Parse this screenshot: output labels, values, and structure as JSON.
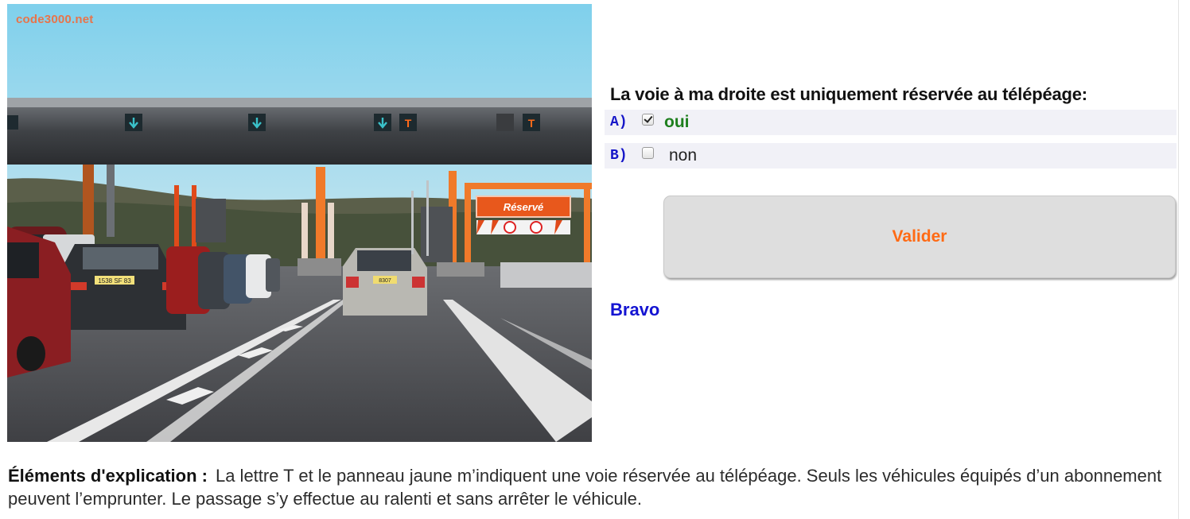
{
  "photo": {
    "watermark": "code3000.net",
    "sign_text": "Réservé",
    "plate_left": "1538 SF 83",
    "plate_center": "8307"
  },
  "question": {
    "text": "La voie à ma droite est uniquement réservée au télépéage:",
    "answers": [
      {
        "letter": "A)",
        "label": "oui",
        "checked": true
      },
      {
        "letter": "B)",
        "label": "non",
        "checked": false
      }
    ]
  },
  "button": {
    "label": "Valider"
  },
  "feedback": {
    "text": "Bravo"
  },
  "explanation": {
    "title": "Éléments d'explication :",
    "body": "La lettre T et le panneau jaune m’indiquent une voie réservée au télépéage. Seuls les véhicules équipés d’un abonnement peuvent l’emprunter. Le passage s’y effectue au ralenti et sans arrêter le véhicule."
  },
  "colors": {
    "question_letters": "#1616c8",
    "correct_answer": "#1e7f1e",
    "button_text": "#ff6a14",
    "feedback": "#1414d2"
  }
}
